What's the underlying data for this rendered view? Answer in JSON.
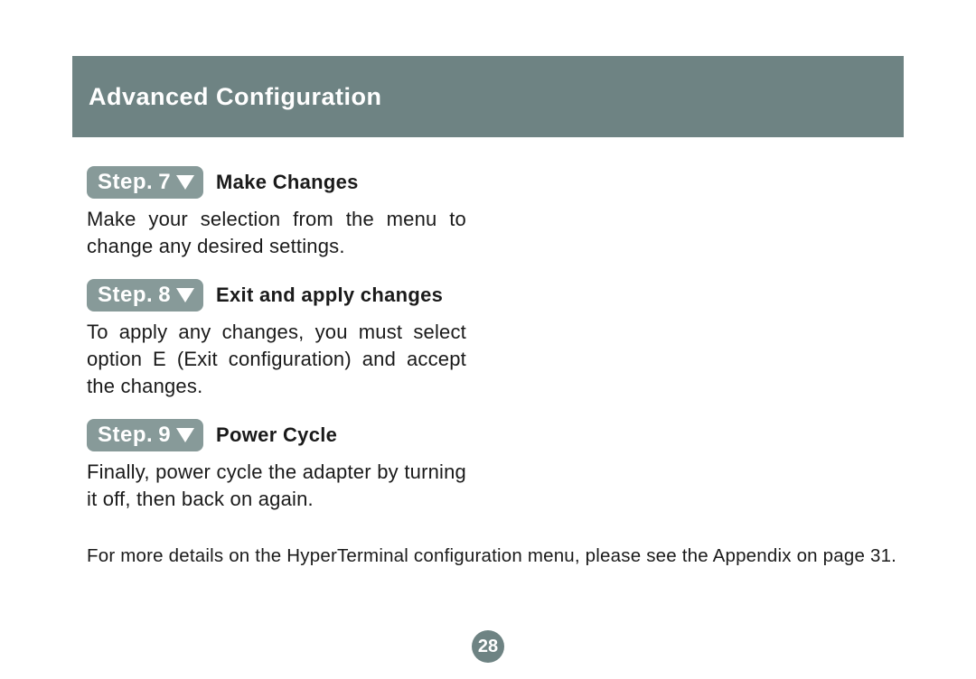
{
  "header": {
    "title": "Advanced  Configuration"
  },
  "steps": [
    {
      "badge_word": "Step.",
      "badge_num": "7",
      "title": "Make Changes",
      "body": "Make your selection from the menu to change any desired settings."
    },
    {
      "badge_word": "Step.",
      "badge_num": "8",
      "title": "Exit and apply changes",
      "body": "To apply any changes, you must select option E (Exit configuration) and accept the changes."
    },
    {
      "badge_word": "Step.",
      "badge_num": "9",
      "title": "Power Cycle",
      "body": "Finally, power cycle the adapter by turning it off, then back on again."
    }
  ],
  "footer_note": "For more details on the HyperTerminal configuration menu, please see the Appendix on page 31.",
  "page_number": "28",
  "colors": {
    "header_bg": "#6e8383",
    "badge_bg": "#879a99",
    "page_circle_bg": "#6e8383"
  }
}
